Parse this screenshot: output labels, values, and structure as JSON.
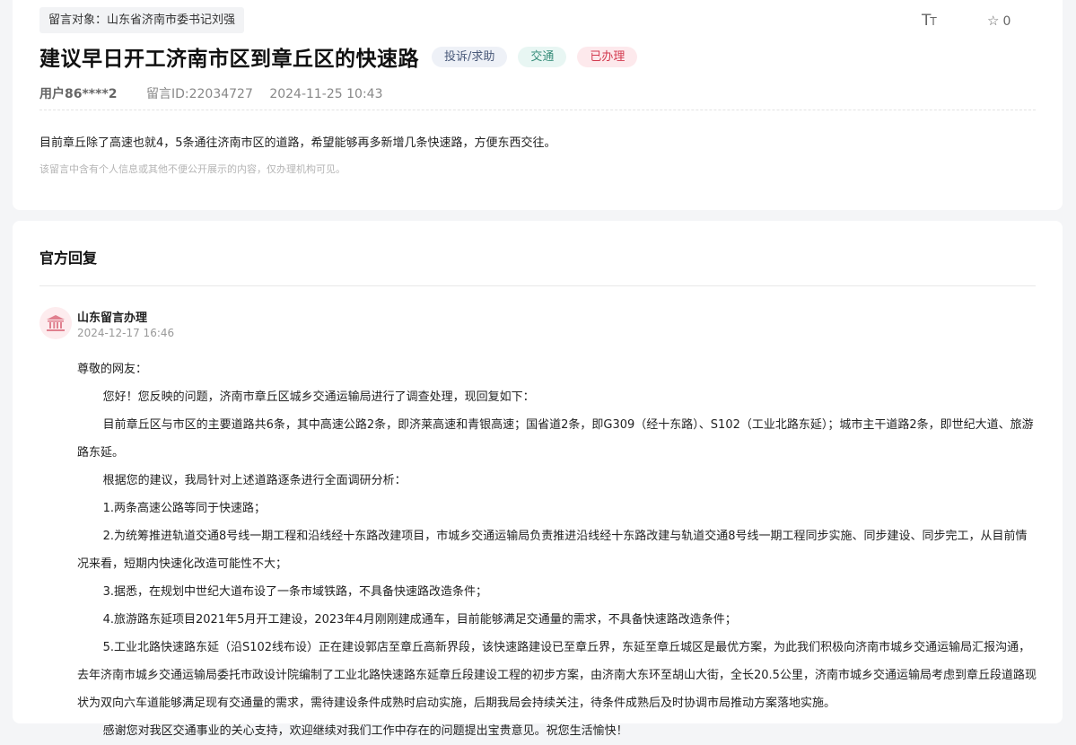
{
  "message": {
    "target": "留言对象：山东省济南市委书记刘强",
    "title": "建议早日开工济南市区到章丘区的快速路",
    "tags": {
      "type": "投诉/求助",
      "category": "交通",
      "status": "已办理"
    },
    "user": "用户86****2",
    "message_id": "留言ID:22034727",
    "datetime": "2024-11-25 10:43",
    "content": "目前章丘除了高速也就4，5条通往济南市区的道路，希望能够再多新增几条快速路，方便东西交往。",
    "privacy_note": "该留言中含有个人信息或其他不便公开展示的内容，仅办理机构可见。"
  },
  "toolbar": {
    "font_size_icon": "font-size-icon",
    "favorite_icon": "star-outline-icon",
    "favorite_count": "0"
  },
  "reply": {
    "heading": "官方回复",
    "org_name": "山东留言办理",
    "org_icon": "government-building-icon",
    "datetime": "2024-12-17 16:46",
    "paragraphs": [
      "尊敬的网友：",
      "您好！您反映的问题，济南市章丘区城乡交通运输局进行了调查处理，现回复如下：",
      "目前章丘区与市区的主要道路共6条，其中高速公路2条，即济莱高速和青银高速；国省道2条，即G309（经十东路）、S102（工业北路东延）；城市主干道路2条，即世纪大道、旅游路东延。",
      "根据您的建议，我局针对上述道路逐条进行全面调研分析：",
      "1.两条高速公路等同于快速路；",
      "2.为统筹推进轨道交通8号线一期工程和沿线经十东路改建项目，市城乡交通运输局负责推进沿线经十东路改建与轨道交通8号线一期工程同步实施、同步建设、同步完工，从目前情况来看，短期内快速化改造可能性不大；",
      "3.据悉，在规划中世纪大道布设了一条市域铁路，不具备快速路改造条件；",
      "4.旅游路东延项目2021年5月开工建设，2023年4月刚刚建成通车，目前能够满足交通量的需求，不具备快速路改造条件；",
      "5.工业北路快速路东延（沿S102线布设）正在建设郭店至章丘高新界段，该快速路建设已至章丘界，东延至章丘城区是最优方案，为此我们积极向济南市城乡交通运输局汇报沟通，去年济南市城乡交通运输局委托市政设计院编制了工业北路快速路东延章丘段建设工程的初步方案，由济南大东环至胡山大街，全长20.5公里，济南市城乡交通运输局考虑到章丘段道路现状为双向六车道能够满足现有交通量的需求，需待建设条件成熟时启动实施，后期我局会持续关注，待条件成熟后及时协调市局推动方案落地实施。",
      "感谢您对我区交通事业的关心支持，欢迎继续对我们工作中存在的问题提出宝贵意见。祝您生活愉快！"
    ]
  },
  "colors": {
    "page_bg": "#f4f5f7",
    "status_tag": "#d33a4f",
    "category_tag": "#3a8f7c",
    "type_tag": "#4a5a7a",
    "org_icon": "#e0808f"
  }
}
